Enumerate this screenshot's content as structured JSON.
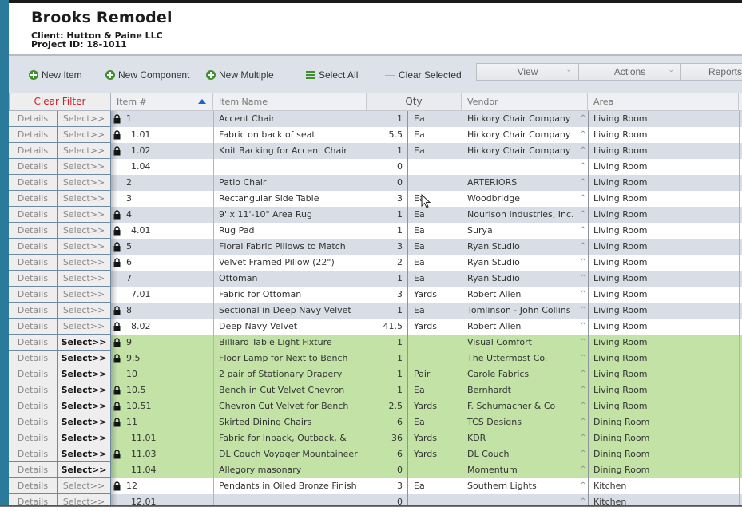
{
  "project": {
    "title": "Brooks Remodel",
    "client": "Client: Hutton & Paine LLC",
    "project_id": "Project ID: 18-1011"
  },
  "toolbar": {
    "new_item": "New Item",
    "new_component": "New Component",
    "new_multiple": "New Multiple",
    "select_all": "Select All",
    "clear_selected": "Clear Selected",
    "view": "View",
    "actions": "Actions",
    "reports": "Reports"
  },
  "grid": {
    "clear_filter": "Clear Filter",
    "columns": {
      "item": "Item #",
      "name": "Item Name",
      "qty": "Qty",
      "vendor": "Vendor",
      "area": "Area"
    },
    "sort": {
      "column": "Item #",
      "direction": "ascending"
    },
    "row_buttons": {
      "details": "Details",
      "select": "Select>>"
    },
    "caret": "^",
    "rows": [
      {
        "item": "1",
        "sub": false,
        "locked": true,
        "name": "Accent Chair",
        "qty": "1",
        "unit": "Ea",
        "vendor": "Hickory Chair Company",
        "area": "Living Room",
        "selected": false
      },
      {
        "item": "1.01",
        "sub": true,
        "locked": true,
        "name": "Fabric on back of seat",
        "qty": "5.5",
        "unit": "Ea",
        "vendor": "Hickory Chair Company",
        "area": "Living Room",
        "selected": false
      },
      {
        "item": "1.02",
        "sub": true,
        "locked": true,
        "name": "Knit Backing for Accent Chair",
        "qty": "1",
        "unit": "Ea",
        "vendor": "Hickory Chair Company",
        "area": "Living Room",
        "selected": false
      },
      {
        "item": "1.04",
        "sub": true,
        "locked": false,
        "name": "",
        "qty": "0",
        "unit": "",
        "vendor": "",
        "area": "Living Room",
        "selected": false
      },
      {
        "item": "2",
        "sub": false,
        "locked": false,
        "name": "Patio Chair",
        "qty": "0",
        "unit": "",
        "vendor": "ARTERIORS",
        "area": "Living Room",
        "selected": false
      },
      {
        "item": "3",
        "sub": false,
        "locked": false,
        "name": "Rectangular Side Table",
        "qty": "3",
        "unit": "Ea",
        "vendor": "Woodbridge",
        "area": "Living Room",
        "selected": false
      },
      {
        "item": "4",
        "sub": false,
        "locked": true,
        "name": "9' x 11'-10\" Area Rug",
        "qty": "1",
        "unit": "Ea",
        "vendor": "Nourison Industries, Inc.",
        "area": "Living Room",
        "selected": false
      },
      {
        "item": "4.01",
        "sub": true,
        "locked": true,
        "name": "Rug Pad",
        "qty": "1",
        "unit": "Ea",
        "vendor": "Surya",
        "area": "Living Room",
        "selected": false
      },
      {
        "item": "5",
        "sub": false,
        "locked": true,
        "name": "Floral Fabric Pillows to Match",
        "qty": "3",
        "unit": "Ea",
        "vendor": "Ryan Studio",
        "area": "Living Room",
        "selected": false
      },
      {
        "item": "6",
        "sub": false,
        "locked": true,
        "name": "Velvet Framed Pillow (22\")",
        "qty": "2",
        "unit": "Ea",
        "vendor": "Ryan Studio",
        "area": "Living Room",
        "selected": false
      },
      {
        "item": "7",
        "sub": false,
        "locked": false,
        "name": "Ottoman",
        "qty": "1",
        "unit": "Ea",
        "vendor": "Ryan Studio",
        "area": "Living Room",
        "selected": false
      },
      {
        "item": "7.01",
        "sub": true,
        "locked": false,
        "name": "Fabric for Ottoman",
        "qty": "3",
        "unit": "Yards",
        "vendor": "Robert Allen",
        "area": "Living Room",
        "selected": false
      },
      {
        "item": "8",
        "sub": false,
        "locked": true,
        "name": "Sectional in Deep Navy Velvet",
        "qty": "1",
        "unit": "Ea",
        "vendor": "Tomlinson - John Collins",
        "area": "Living Room",
        "selected": false
      },
      {
        "item": "8.02",
        "sub": true,
        "locked": true,
        "name": "Deep Navy Velvet",
        "qty": "41.5",
        "unit": "Yards",
        "vendor": "Robert Allen",
        "area": "Living Room",
        "selected": false
      },
      {
        "item": "9",
        "sub": false,
        "locked": true,
        "name": "Billiard Table Light Fixture",
        "qty": "1",
        "unit": "",
        "vendor": "Visual Comfort",
        "area": "Living Room",
        "selected": true
      },
      {
        "item": "9.5",
        "sub": false,
        "locked": true,
        "name": "Floor Lamp for Next to Bench",
        "qty": "1",
        "unit": "",
        "vendor": "The Uttermost Co.",
        "area": "Living Room",
        "selected": true
      },
      {
        "item": "10",
        "sub": false,
        "locked": false,
        "name": "2 pair of Stationary Drapery",
        "qty": "1",
        "unit": "Pair",
        "vendor": "Carole Fabrics",
        "area": "Living Room",
        "selected": true
      },
      {
        "item": "10.5",
        "sub": false,
        "locked": true,
        "name": "Bench in Cut Velvet Chevron",
        "qty": "1",
        "unit": "Ea",
        "vendor": "Bernhardt",
        "area": "Living Room",
        "selected": true
      },
      {
        "item": "10.51",
        "sub": false,
        "locked": true,
        "name": "Chevron Cut Velvet for Bench",
        "qty": "2.5",
        "unit": "Yards",
        "vendor": "F. Schumacher & Co",
        "area": "Living Room",
        "selected": true
      },
      {
        "item": "11",
        "sub": false,
        "locked": true,
        "name": "Skirted Dining Chairs",
        "qty": "6",
        "unit": "Ea",
        "vendor": "TCS Designs",
        "area": "Dining Room",
        "selected": true
      },
      {
        "item": "11.01",
        "sub": true,
        "locked": false,
        "name": "Fabric for Inback, Outback, &",
        "qty": "36",
        "unit": "Yards",
        "vendor": "KDR",
        "area": "Dining Room",
        "selected": true
      },
      {
        "item": "11.03",
        "sub": true,
        "locked": true,
        "name": "DL Couch Voyager Mountaineer",
        "qty": "6",
        "unit": "Yards",
        "vendor": "DL Couch",
        "area": "Dining Room",
        "selected": true
      },
      {
        "item": "11.04",
        "sub": true,
        "locked": false,
        "name": "Allegory masonary",
        "qty": "0",
        "unit": "",
        "vendor": "Momentum",
        "area": "Dining Room",
        "selected": true
      },
      {
        "item": "12",
        "sub": false,
        "locked": true,
        "name": "Pendants in Oiled Bronze Finish",
        "qty": "3",
        "unit": "Ea",
        "vendor": "Southern Lights",
        "area": "Kitchen",
        "selected": false
      },
      {
        "item": "12.01",
        "sub": true,
        "locked": false,
        "name": "",
        "qty": "0",
        "unit": "",
        "vendor": "",
        "area": "Kitchen",
        "selected": false
      }
    ]
  },
  "colors": {
    "accent_green": "#3f8f2a",
    "selected_row": "#c3e2a6",
    "alt_row": "#d9dde5",
    "clear_filter_red": "#d0202a",
    "sort_arrow_blue": "#1565d8",
    "left_strip": "#2a7a9c"
  }
}
